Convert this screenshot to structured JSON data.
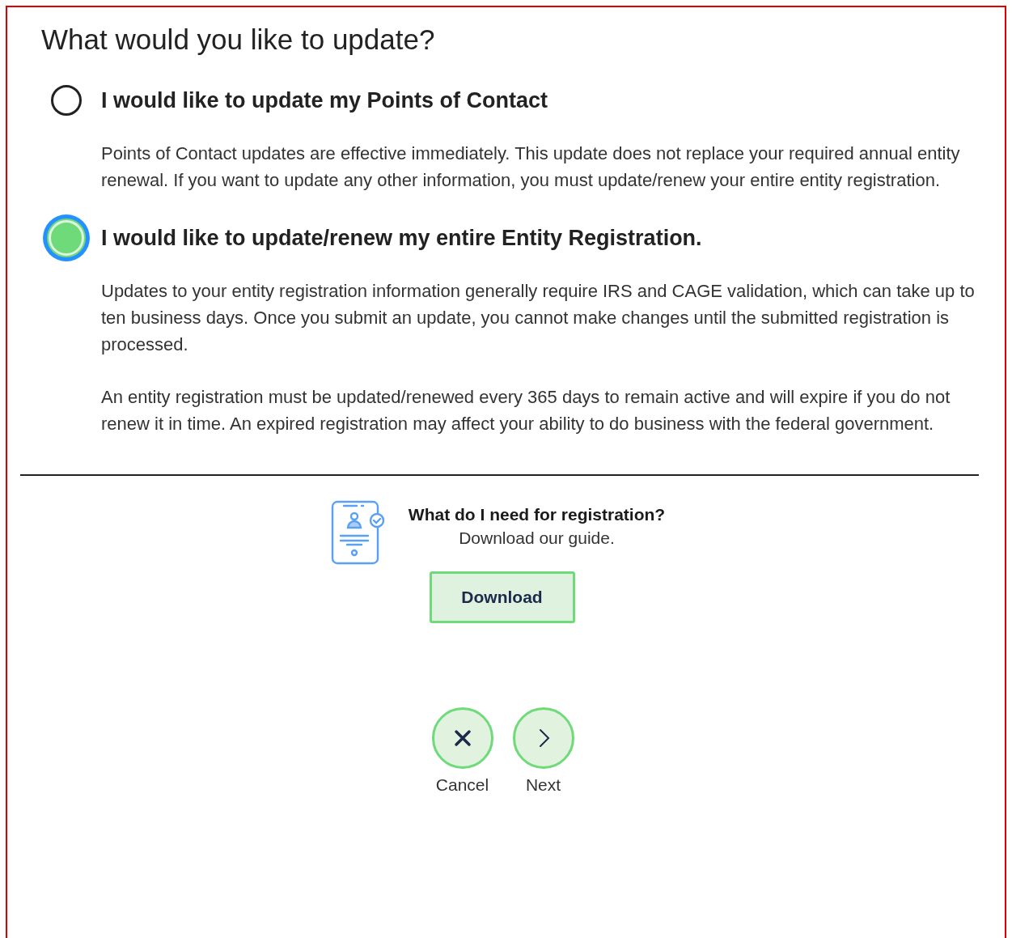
{
  "heading": "What would you like to update?",
  "options": [
    {
      "label": "I would like to update my Points of Contact",
      "selected": false,
      "paragraphs": [
        "Points of Contact updates are effective immediately. This update does not replace your required annual entity renewal. If you want to update any other information, you must update/renew your entire entity registration."
      ]
    },
    {
      "label": "I would like to update/renew my entire Entity Registration.",
      "selected": true,
      "paragraphs": [
        "Updates to your entity registration information generally require IRS and CAGE validation, which can take up to ten business days. Once you submit an update, you cannot make changes until the submitted registration is processed.",
        "An entity registration must be updated/renewed every 365 days to remain active and will expire if you do not renew it in time. An expired registration may affect your ability to do business with the federal government."
      ]
    }
  ],
  "guide": {
    "title": "What do I need for registration?",
    "subtitle": "Download our guide.",
    "button": "Download"
  },
  "actions": [
    {
      "kind": "cancel",
      "label": "Cancel"
    },
    {
      "kind": "next",
      "label": "Next"
    }
  ]
}
